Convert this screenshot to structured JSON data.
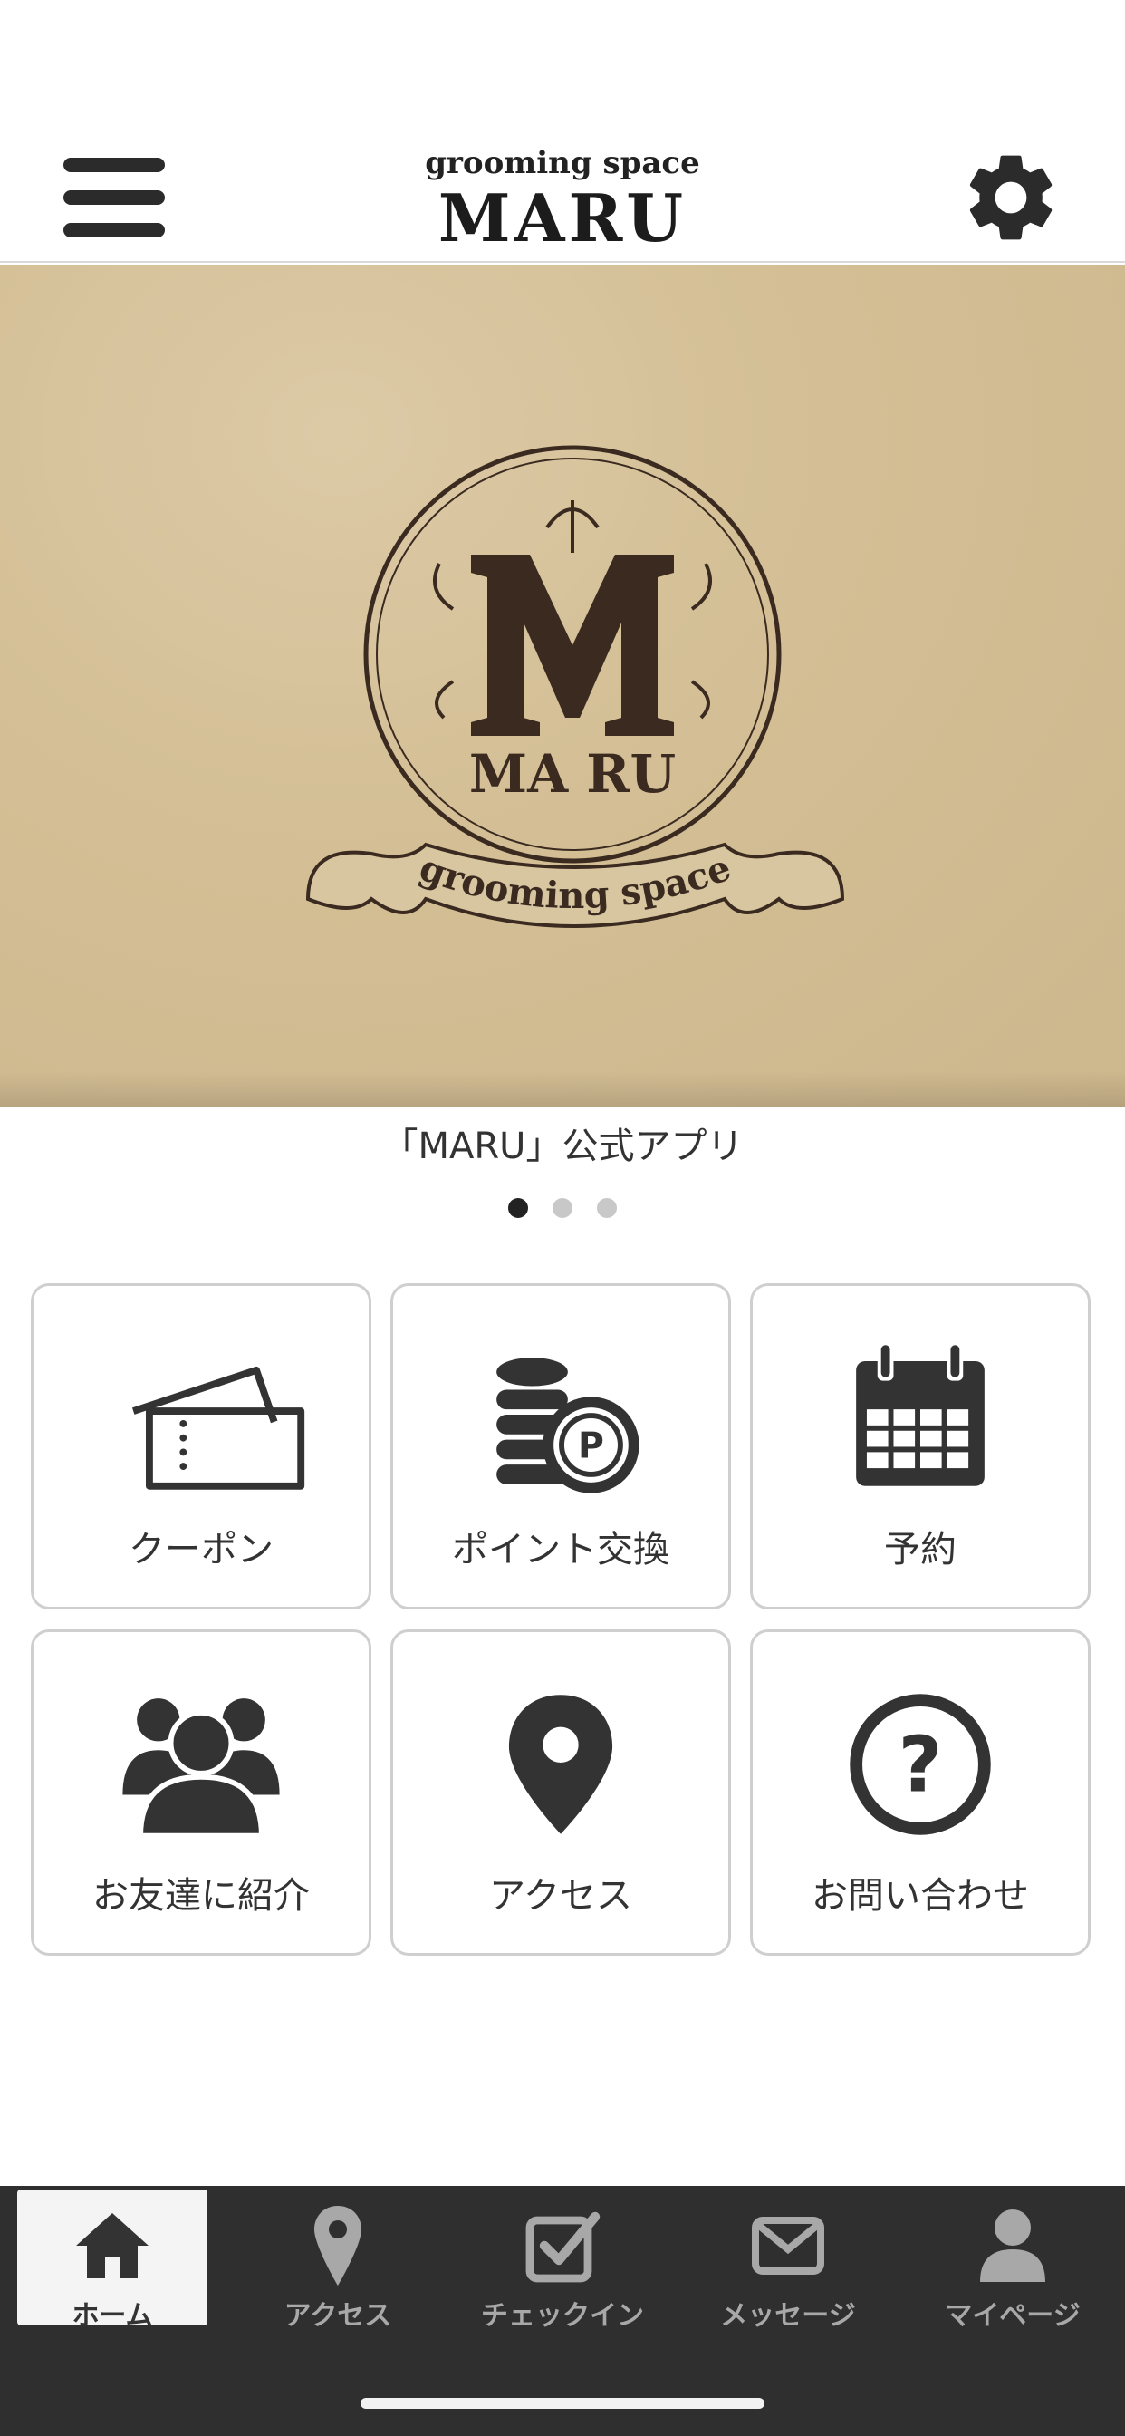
{
  "header": {
    "logo_sub": "grooming space",
    "logo_main": "MARU",
    "menu_icon": "hamburger-menu-icon",
    "settings_icon": "gear-icon"
  },
  "banner": {
    "logo_text_main": "MA RU",
    "logo_text_ribbon": "grooming space",
    "caption": "「MARU」公式アプリ",
    "page_count": 3,
    "active_page": 1
  },
  "menu": [
    {
      "label": "クーポン",
      "icon": "ticket-icon"
    },
    {
      "label": "ポイント交換",
      "icon": "coins-point-icon"
    },
    {
      "label": "予約",
      "icon": "calendar-icon"
    },
    {
      "label": "お友達に紹介",
      "icon": "users-icon"
    },
    {
      "label": "アクセス",
      "icon": "map-pin-icon"
    },
    {
      "label": "お問い合わせ",
      "icon": "question-icon"
    }
  ],
  "tabbar": {
    "items": [
      {
        "label": "ホーム",
        "icon": "home-icon",
        "active": true
      },
      {
        "label": "アクセス",
        "icon": "map-pin-icon"
      },
      {
        "label": "チェックイン",
        "icon": "checkin-icon"
      },
      {
        "label": "メッセージ",
        "icon": "mail-icon"
      },
      {
        "label": "マイページ",
        "icon": "person-icon"
      }
    ]
  },
  "colors": {
    "icon": "#333333",
    "tabbar_bg": "#2f2f2f",
    "tab_inactive": "#a8a8a8",
    "banner_bg": "#d4bf96",
    "tile_border": "#cfcfcf"
  }
}
